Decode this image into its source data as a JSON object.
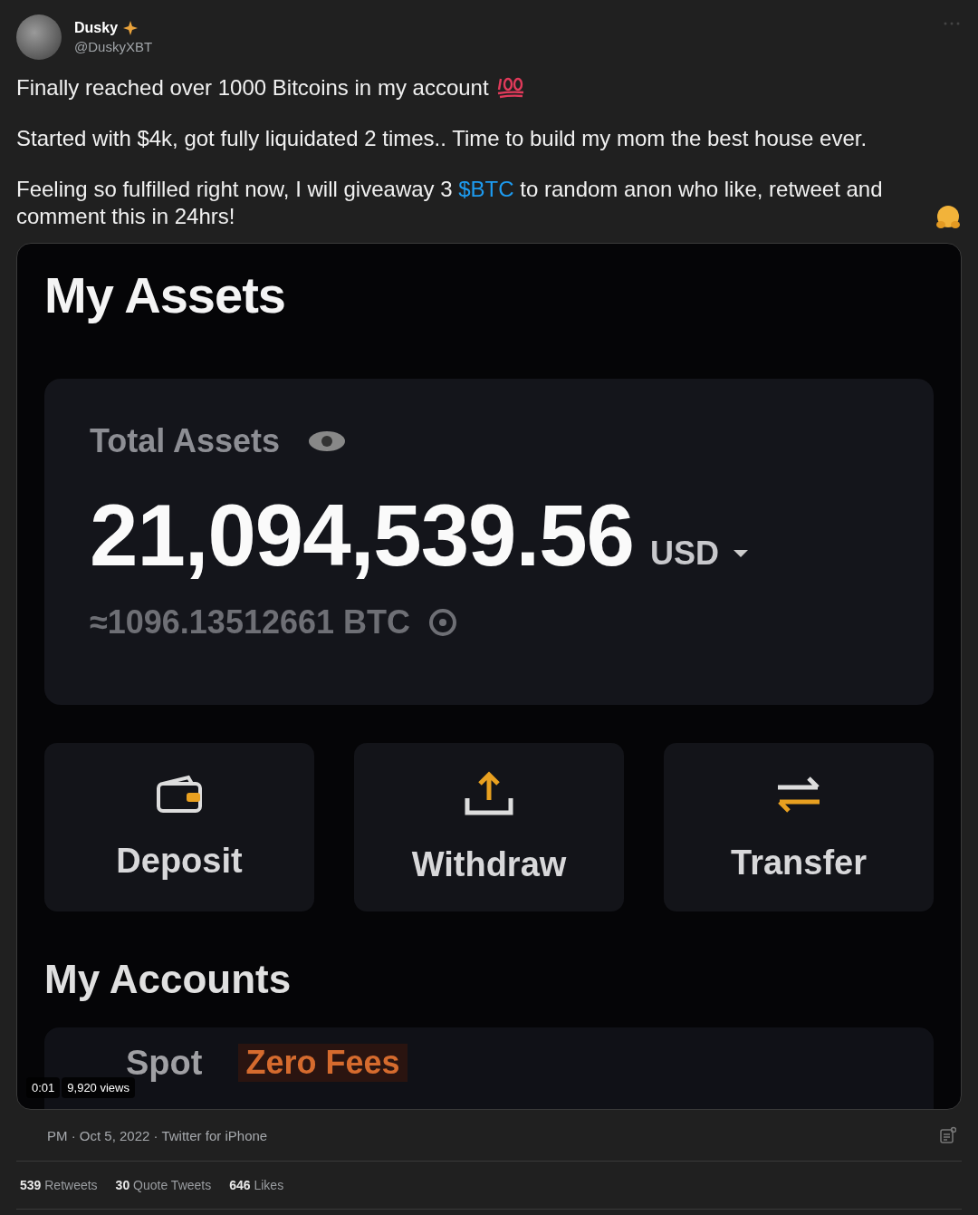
{
  "author": {
    "name": "Dusky",
    "handle": "@DuskyXBT"
  },
  "paragraphs": [
    {
      "kind": "hundred",
      "segments": [
        {
          "text": "Finally reached over 1000 Bitcoins in my account"
        }
      ]
    },
    {
      "kind": "plain",
      "segments": [
        {
          "text": "Started with $4k, got fully liquidated 2 times.. Time to build my mom the best house ever."
        }
      ]
    },
    {
      "segments": [
        {
          "text": "Feeling so fulfilled right now, I will giveaway 3 "
        },
        {
          "text": "$BTC",
          "kind": "cashtag"
        },
        {
          "text": " to random anon who like, retweet and comment this in 24hrs!"
        }
      ],
      "kind": "hug"
    }
  ],
  "video": {
    "time": "0:01",
    "views": "9,920 views",
    "screen": {
      "title": "My Assets",
      "total_label": "Total Assets",
      "total_value": "21,094,539.56",
      "currency": "USD",
      "btc_value": "≈1096.13512661 BTC",
      "actions": [
        {
          "kind": "deposit",
          "label": "Deposit"
        },
        {
          "kind": "withdraw",
          "label": "Withdraw"
        },
        {
          "kind": "transfer",
          "label": "Transfer"
        }
      ],
      "accounts_title": "My Accounts",
      "account": {
        "name": "Spot",
        "tag": "Zero Fees"
      }
    }
  },
  "meta": "PM · Oct 5, 2022 · Twitter for iPhone",
  "stats": [
    {
      "count": "539",
      "label": "Retweets"
    },
    {
      "count": "30",
      "label": "Quote Tweets"
    },
    {
      "count": "646",
      "label": "Likes"
    }
  ]
}
